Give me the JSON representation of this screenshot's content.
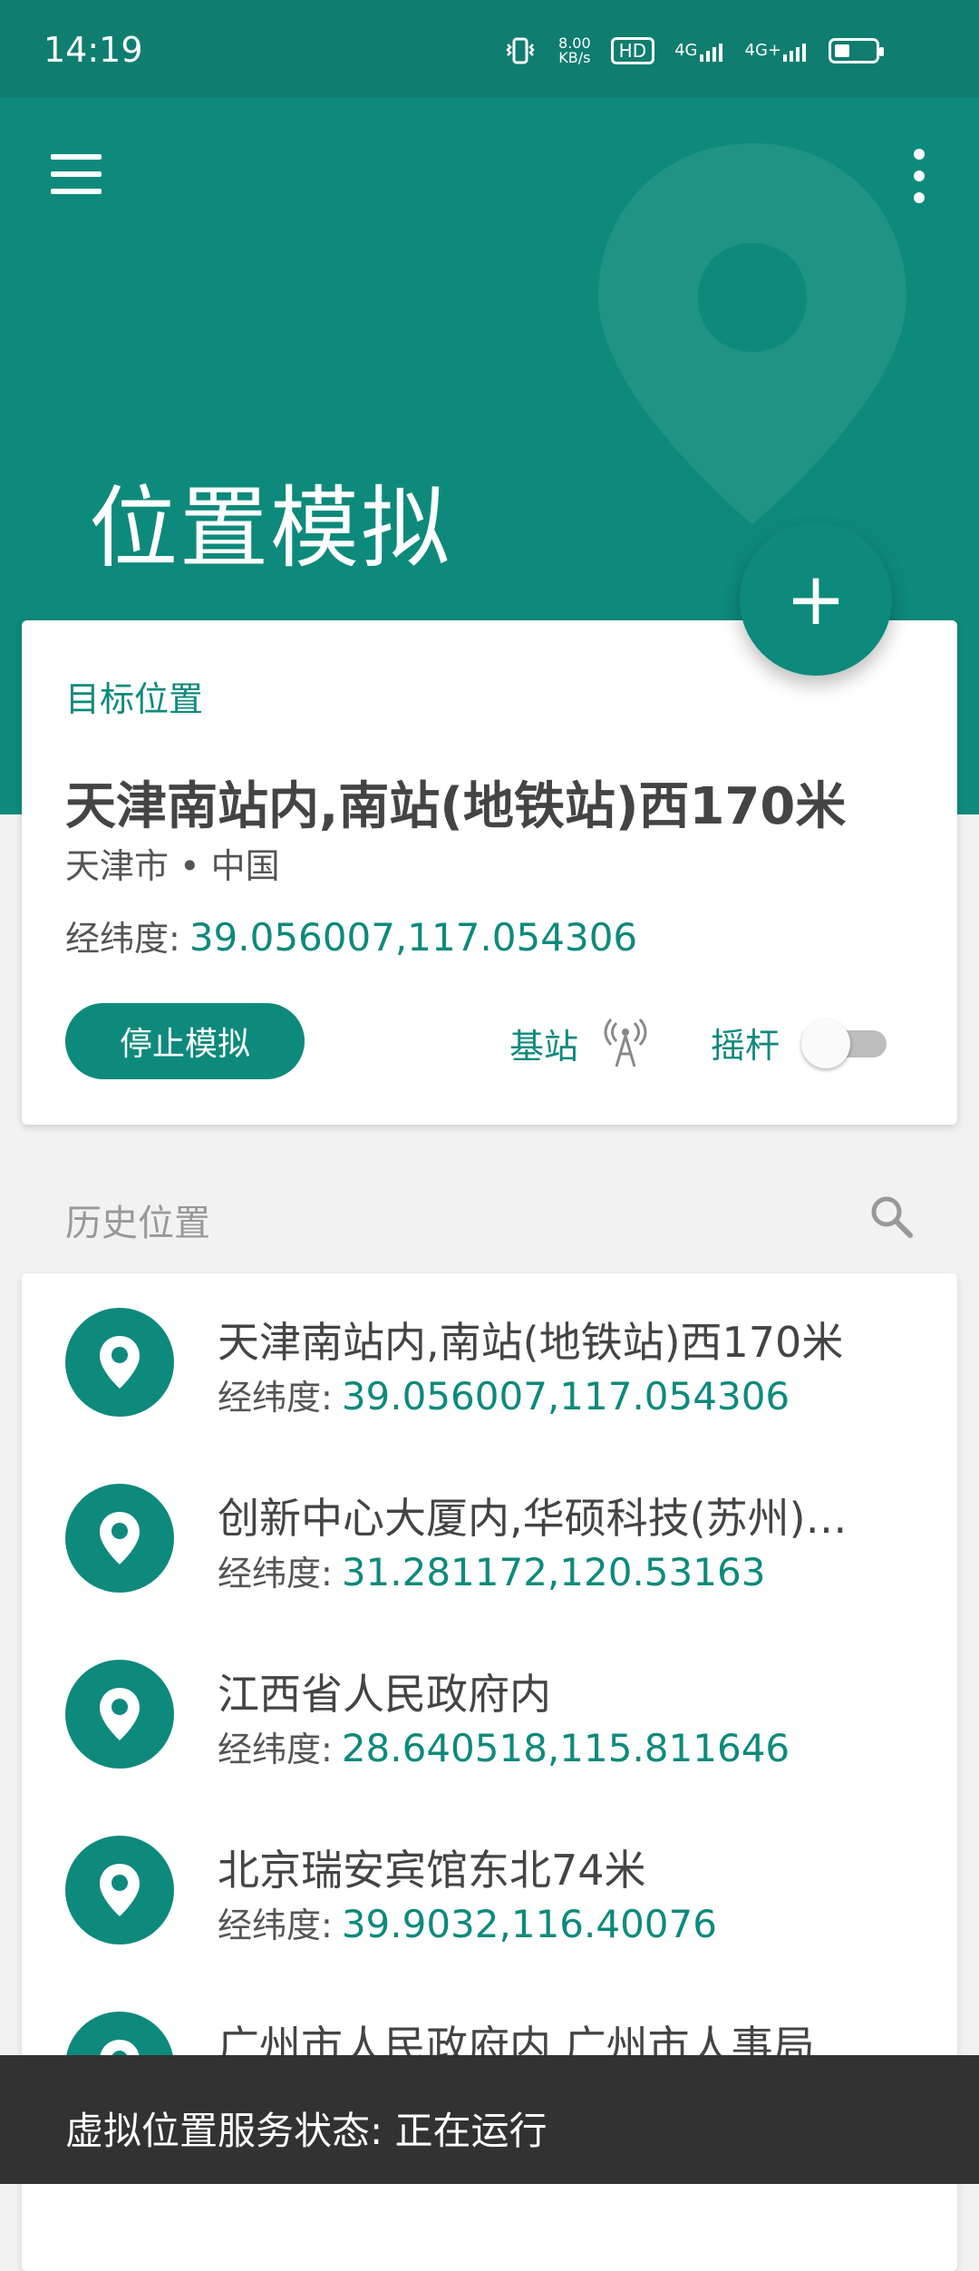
{
  "status_bar": {
    "time": "14:19",
    "speed_value": "8.00",
    "speed_unit": "KB/s",
    "hd": "HD",
    "sim1": "4G",
    "sim2": "4G+"
  },
  "header": {
    "title": "位置模拟"
  },
  "fab": {
    "label": "+"
  },
  "target": {
    "label": "目标位置",
    "title": "天津南站内,南站(地铁站)西170米",
    "subtitle": "天津市 • 中国",
    "coords_label": "经纬度:",
    "coords_value": "39.056007,117.054306",
    "stop_button": "停止模拟",
    "base_station_label": "基站",
    "joystick_label": "摇杆"
  },
  "history": {
    "label": "历史位置",
    "items": [
      {
        "title": "天津南站内,南站(地铁站)西170米",
        "coords_label": "经纬度:",
        "coords": "39.056007,117.054306"
      },
      {
        "title": "创新中心大厦内,华硕科技(苏州)…",
        "coords_label": "经纬度:",
        "coords": "31.281172,120.53163"
      },
      {
        "title": "江西省人民政府内",
        "coords_label": "经纬度:",
        "coords": "28.640518,115.811646"
      },
      {
        "title": "北京瑞安宾馆东北74米",
        "coords_label": "经纬度:",
        "coords": "39.9032,116.40076"
      },
      {
        "title": "广州市人民政府内,广州市人事局…",
        "coords_label": "经纬度:",
        "coords": ""
      }
    ]
  },
  "snackbar": {
    "text": "虚拟位置服务状态: 正在运行"
  },
  "colors": {
    "primary": "#0d8a7b",
    "status_bar": "#0f7d6f",
    "snackbar": "#323232"
  }
}
